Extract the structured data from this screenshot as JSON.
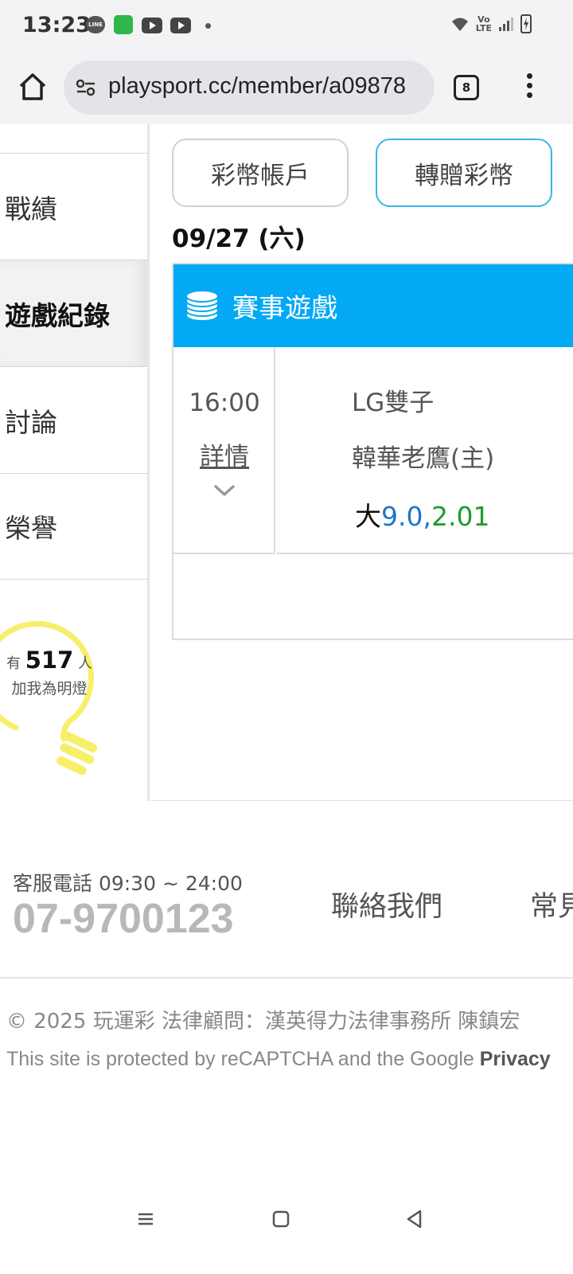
{
  "status_bar": {
    "time": "13:23",
    "line_badge": "LINE",
    "icons": [
      "line-icon",
      "green-app-icon",
      "youtube-icon",
      "youtube-icon",
      "dot-icon",
      "wifi-icon",
      "volte-icon",
      "signal-icon",
      "battery-charging-icon"
    ],
    "volte_top": "Vo",
    "volte_bottom": "LTE"
  },
  "browser": {
    "url": "playsport.cc/member/a09878",
    "tab_count": "8"
  },
  "sidebar": {
    "items": [
      {
        "label": "戰績",
        "active": false
      },
      {
        "label": "遊戲紀錄",
        "active": true
      },
      {
        "label": "討論",
        "active": false
      },
      {
        "label": "榮譽",
        "active": false
      }
    ],
    "bulb": {
      "prefix": "有",
      "count": "517",
      "suffix": "人",
      "caption": "加我為明燈"
    }
  },
  "main": {
    "tabs": [
      {
        "label": "彩幣帳戶"
      },
      {
        "label": "轉贈彩幣"
      }
    ],
    "date": "09/27 (六)",
    "game": {
      "title": "賽事遊戲",
      "time": "16:00",
      "detail_link": "詳情",
      "team_away": "LG雙子",
      "team_home": "韓華老鷹(主)",
      "bet_side": "大",
      "bet_line": "9.0",
      "bet_separator": ",",
      "bet_payout": "2.01"
    },
    "colors": {
      "header_blue": "#03a9f4",
      "line_blue": "#1b76c9",
      "payout_green": "#1f9a2d",
      "tab_active_border": "#3ab4e8"
    }
  },
  "footer": {
    "service_hours": "客服電話 09:30 ~ 24:00",
    "phone": "07-9700123",
    "contact": "聯絡我們",
    "faq": "常見",
    "copyright": "© 2025 玩運彩 法律顧問：漢英得力法律事務所 陳鎮宏",
    "recaptcha": "This site is protected by reCAPTCHA and the Google ",
    "recaptcha_bold": "Privacy"
  },
  "nav_bar": {
    "icons": [
      "recents-icon",
      "home-icon",
      "back-icon"
    ]
  }
}
